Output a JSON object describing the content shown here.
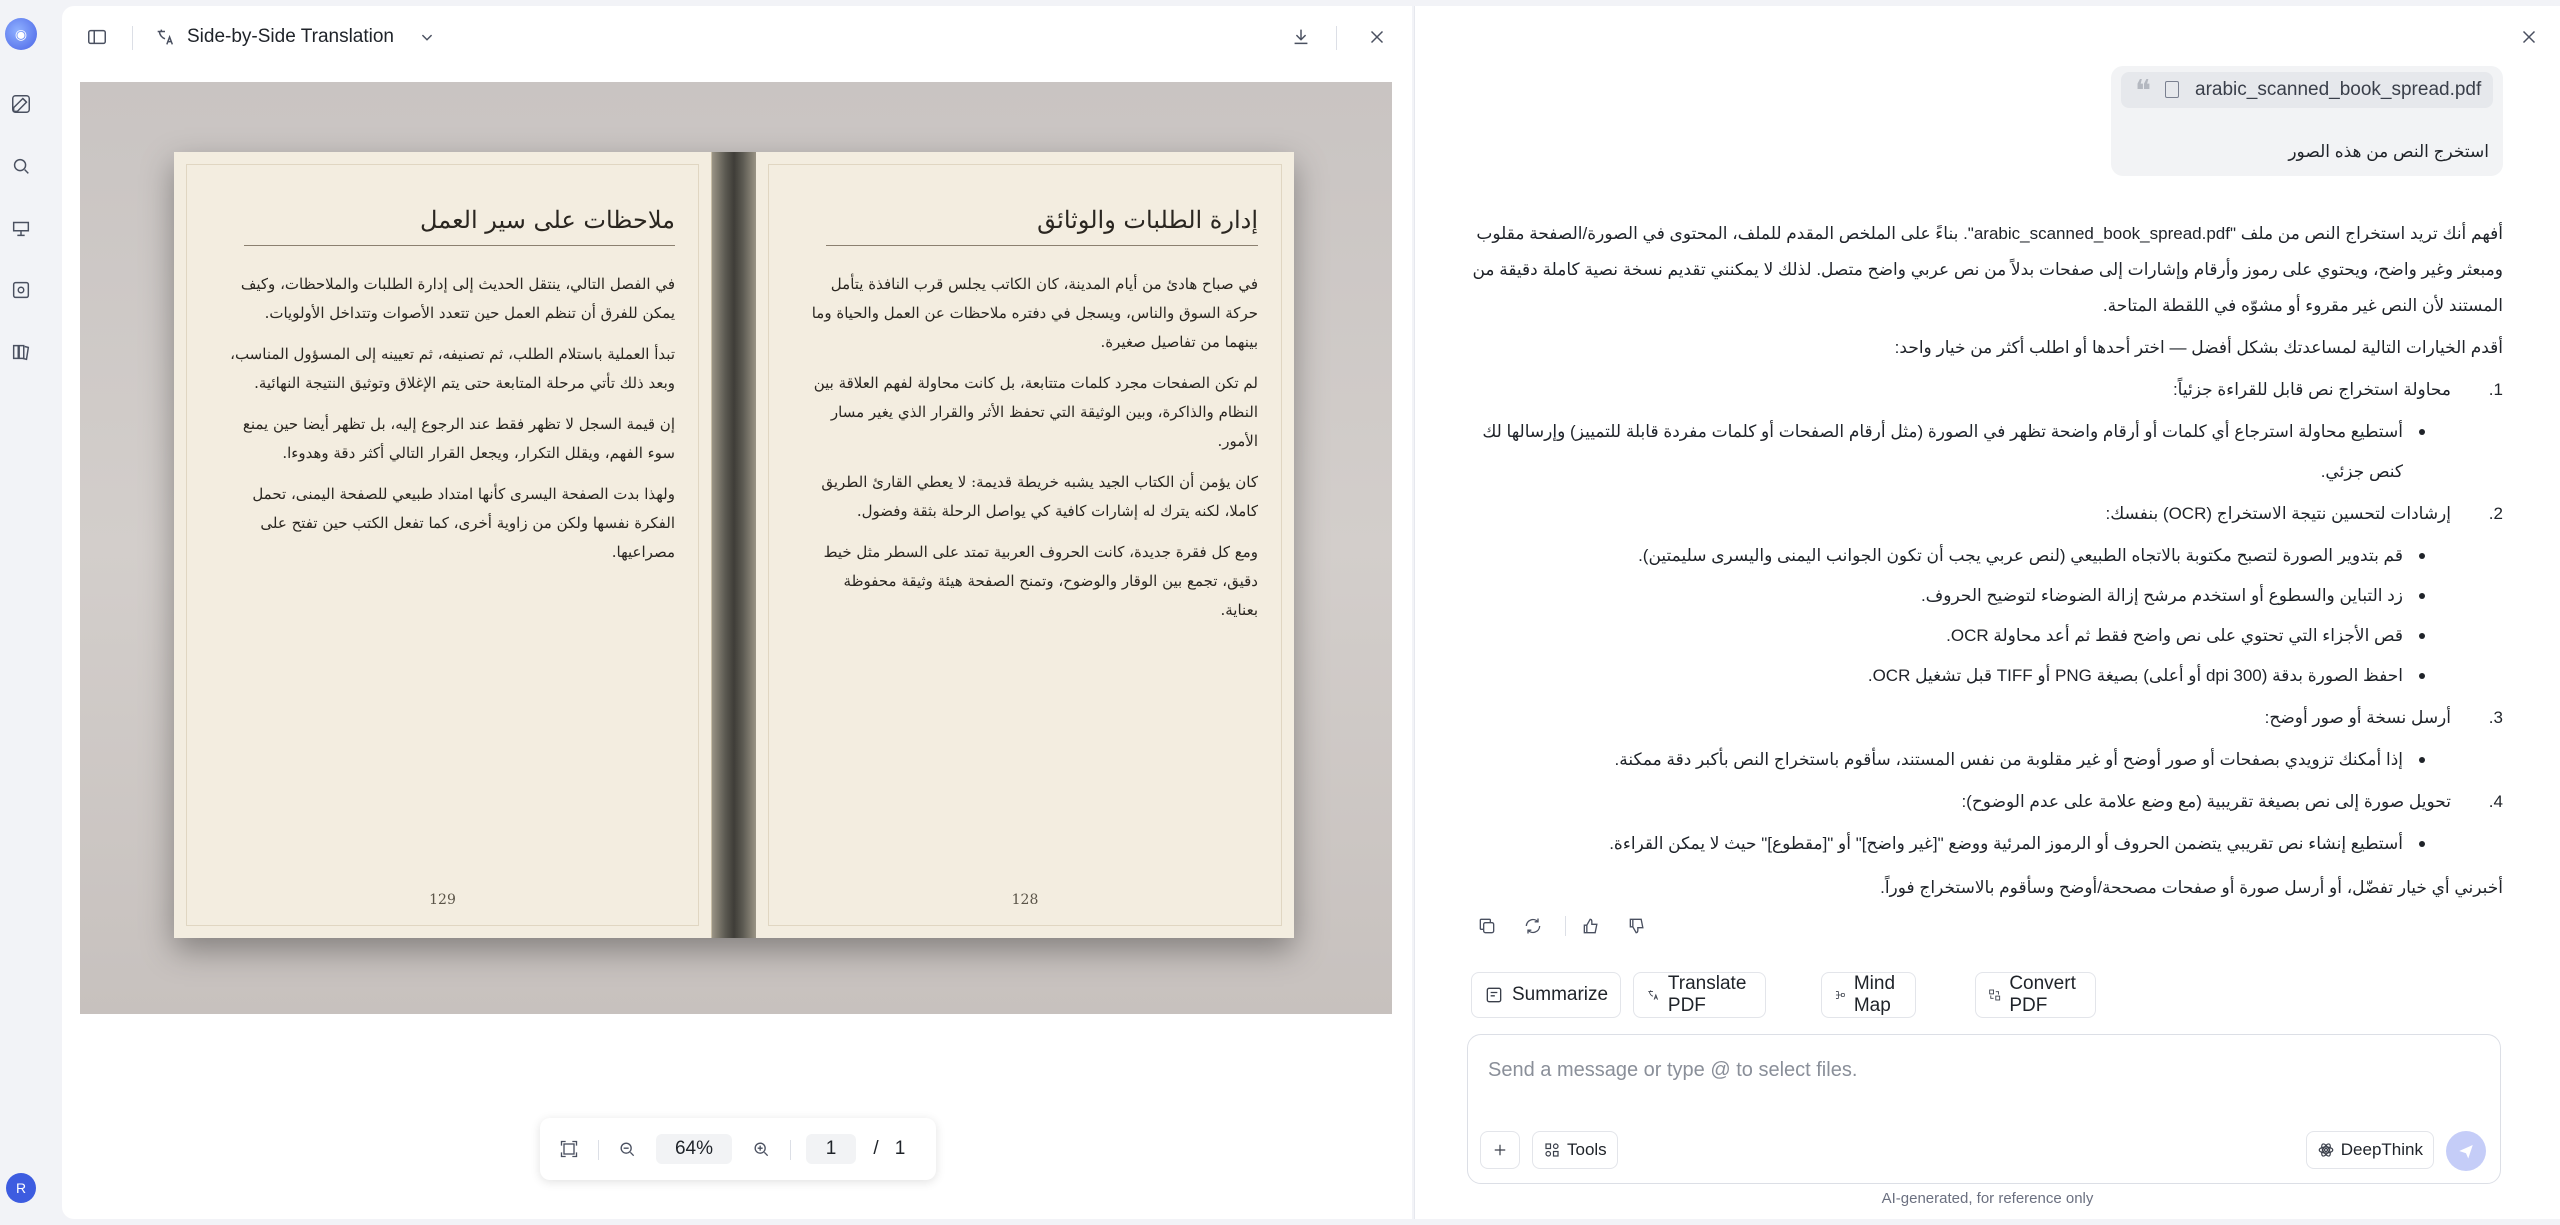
{
  "rail": {
    "avatar_letter": "R"
  },
  "viewer": {
    "title": "Side-by-Side Translation",
    "toolbar": {
      "zoom": "64%",
      "page_current": "1",
      "page_sep": "/",
      "page_total": "1"
    }
  },
  "book": {
    "left_page": {
      "heading": "ملاحظات على سير العمل",
      "paragraphs": [
        "في الفصل التالي، ينتقل الحديث إلى إدارة الطلبات والملاحظات، وكيف يمكن للفرق أن تنظم العمل حين تتعدد الأصوات وتتداخل الأولويات.",
        "تبدأ العملية باستلام الطلب، ثم تصنيفه، ثم تعيينه إلى المسؤول المناسب، وبعد ذلك تأتي مرحلة المتابعة حتى يتم الإغلاق وتوثيق النتيجة النهائية.",
        "إن قيمة السجل لا تظهر فقط عند الرجوع إليه، بل تظهر أيضا حين يمنع سوء الفهم، ويقلل التكرار، ويجعل القرار التالي أكثر دقة وهدوءا.",
        "ولهذا بدت الصفحة اليسرى كأنها امتداد طبيعي للصفحة اليمنى، تحمل الفكرة نفسها ولكن من زاوية أخرى، كما تفعل الكتب حين تفتح على مصراعيها."
      ],
      "page_number": "129"
    },
    "right_page": {
      "heading": "إدارة الطلبات والوثائق",
      "paragraphs": [
        "في صباح هادئ من أيام المدينة، كان الكاتب يجلس قرب النافذة يتأمل حركة السوق والناس، ويسجل في دفتره ملاحظات عن العمل والحياة وما بينهما من تفاصيل صغيرة.",
        "لم تكن الصفحات مجرد كلمات متتابعة، بل كانت محاولة لفهم العلاقة بين النظام والذاكرة، وبين الوثيقة التي تحفظ الأثر والقرار الذي يغير مسار الأمور.",
        "كان يؤمن أن الكتاب الجيد يشبه خريطة قديمة: لا يعطي القارئ الطريق كاملا، لكنه يترك له إشارات كافية كي يواصل الرحلة بثقة وفضول.",
        "ومع كل فقرة جديدة، كانت الحروف العربية تمتد على السطر مثل خيط دقيق، تجمع بين الوقار والوضوح، وتمنح الصفحة هيئة وثيقة محفوظة بعناية."
      ],
      "page_number": "128"
    }
  },
  "chat": {
    "user_message": {
      "file_name": "arabic_scanned_book_spread.pdf",
      "text": "استخرج النص من هذه الصور"
    },
    "answer": {
      "para1": "أفهم أنك تريد استخراج النص من ملف \"arabic_scanned_book_spread.pdf\". بناءً على الملخص المقدم للملف، المحتوى في الصورة/الصفحة مقلوب ومبعثر وغير واضح، ويحتوي على رموز وأرقام وإشارات إلى صفحات بدلاً من نص عربي واضح متصل. لذلك لا يمكنني تقديم نسخة نصية كاملة دقيقة من المستند لأن النص غير مقروء أو مشوّه في اللقطة المتاحة.",
      "intro": "أقدم الخيارات التالية لمساعدتك بشكل أفضل — اختر أحدها أو اطلب أكثر من خيار واحد:",
      "items": [
        {
          "num": "1.",
          "title": "محاولة استخراج نص قابل للقراءة جزئياً:",
          "bullets": [
            "أستطيع محاولة استرجاع أي كلمات أو أرقام واضحة تظهر في الصورة (مثل أرقام الصفحات أو كلمات مفردة قابلة للتمييز) وإرسالها لك كنص جزئي."
          ]
        },
        {
          "num": "2.",
          "title": "إرشادات لتحسين نتيجة الاستخراج (OCR) بنفسك:",
          "bullets": [
            "قم بتدوير الصورة لتصبح مكتوبة بالاتجاه الطبيعي (لنص عربي يجب أن تكون الجوانب اليمنى واليسرى سليمتين).",
            "زد التباين والسطوع أو استخدم مرشح إزالة الضوضاء لتوضيح الحروف.",
            "قص الأجزاء التي تحتوي على نص واضح فقط ثم أعد محاولة OCR.",
            "احفظ الصورة بدقة (300 dpi أو أعلى) بصيغة PNG أو TIFF قبل تشغيل OCR."
          ]
        },
        {
          "num": "3.",
          "title": "أرسل نسخة أو صور أوضح:",
          "bullets": [
            "إذا أمكنك تزويدي بصفحات أو صور أوضح أو غير مقلوبة من نفس المستند، سأقوم باستخراج النص بأكبر دقة ممكنة."
          ]
        },
        {
          "num": "4.",
          "title": "تحويل صورة إلى نص بصيغة تقريبية (مع وضع علامة على عدم الوضوح):",
          "bullets": [
            "أستطيع إنشاء نص تقريبي يتضمن الحروف أو الرموز المرئية ووضع \"[غير واضح]\" أو \"[مقطوع]\" حيث لا يمكن القراءة."
          ]
        }
      ],
      "closing": "أخبرني أي خيار تفضّل، أو أرسل صورة أو صفحات مصححة/أوضح وسأقوم بالاستخراج فوراً."
    },
    "quick_actions": [
      "Summarize",
      "Translate PDF",
      "Mind Map",
      "Convert PDF"
    ],
    "composer": {
      "placeholder": "Send a message or type @ to select files.",
      "tools_label": "Tools",
      "deepthink_label": "DeepThink"
    },
    "disclaimer": "AI-generated, for reference only"
  }
}
